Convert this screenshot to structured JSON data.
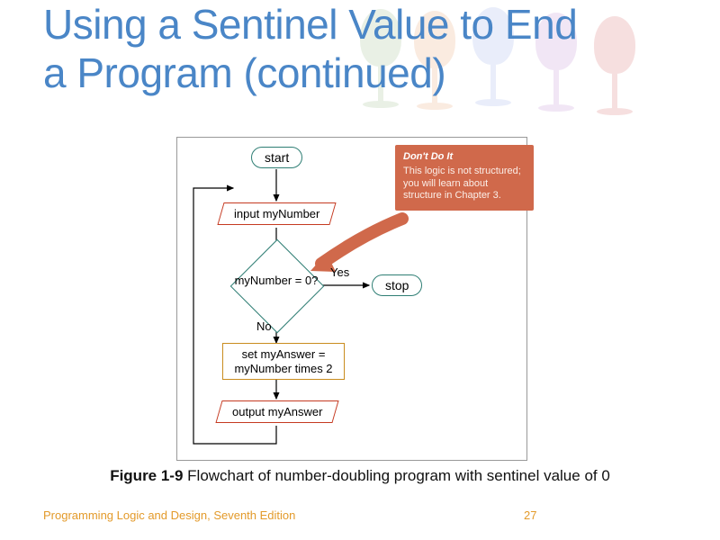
{
  "slide": {
    "title_line1": "Using a Sentinel Value to End",
    "title_line2": "a Program (continued)"
  },
  "flowchart": {
    "start": "start",
    "input": "input myNumber",
    "decision": "myNumber = 0?",
    "yes": "Yes",
    "no": "No",
    "stop": "stop",
    "process": "set myAnswer = myNumber times 2",
    "output": "output myAnswer"
  },
  "callout": {
    "heading": "Don't Do It",
    "body": "This logic is not structured; you will learn about structure in Chapter 3."
  },
  "caption": {
    "label": "Figure 1-9",
    "text": " Flowchart of number-doubling program with sentinel value of 0"
  },
  "footer": {
    "left": "Programming Logic and Design, Seventh Edition",
    "page": "27"
  }
}
